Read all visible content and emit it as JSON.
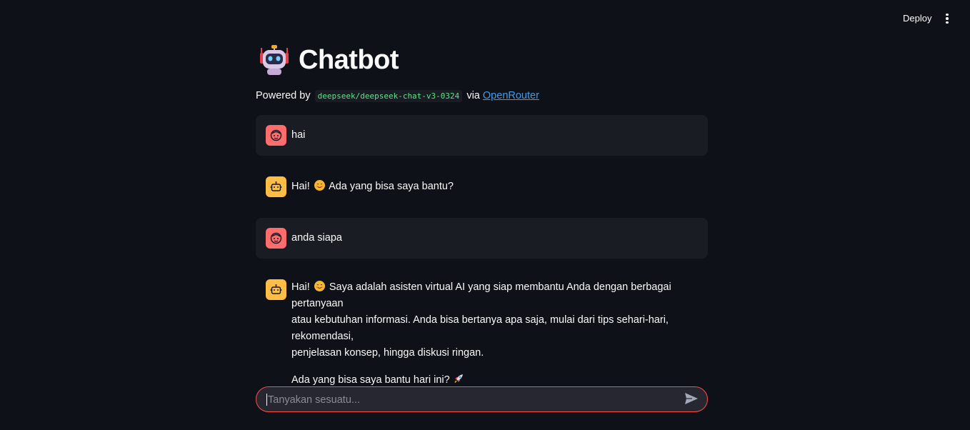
{
  "header": {
    "deploy_label": "Deploy",
    "menu_icon": "kebab-menu-icon"
  },
  "page": {
    "title": "Chatbot",
    "title_icon": "robot-emoji-icon",
    "subtitle_prefix": "Powered by",
    "model_code": "deepseek/deepseek-chat-v3-0324",
    "subtitle_via": "via",
    "provider_link": "OpenRouter"
  },
  "messages": [
    {
      "role": "user",
      "avatar_icon": "user-face-icon",
      "paragraphs": [
        "hai"
      ]
    },
    {
      "role": "assistant",
      "avatar_icon": "robot-icon",
      "text_before_emoji": "Hai!",
      "text_after_emoji": "Ada yang bisa saya bantu?"
    },
    {
      "role": "user",
      "avatar_icon": "user-face-icon",
      "paragraphs": [
        "anda siapa"
      ]
    },
    {
      "role": "assistant",
      "avatar_icon": "robot-icon",
      "p1_before_emoji": "Hai!",
      "p1_line1_after_emoji": "Saya adalah asisten virtual AI yang siap membantu Anda dengan berbagai pertanyaan",
      "p1_line2": "atau kebutuhan informasi. Anda bisa bertanya apa saja, mulai dari tips sehari-hari, rekomendasi,",
      "p1_line3": "penjelasan konsep, hingga diskusi ringan.",
      "p2": "Ada yang bisa saya bantu hari ini?"
    }
  ],
  "chat_input": {
    "placeholder": "Tanyakan sesuatu...",
    "value": "",
    "send_icon": "send-icon"
  },
  "colors": {
    "background": "#0e1117",
    "user_message_bg": "#1a1c24",
    "user_avatar": "#ff6c6c",
    "bot_avatar": "#ffbd45",
    "input_border": "#ff4b4b",
    "link": "#3d9df3",
    "code_text": "#5ce488"
  }
}
